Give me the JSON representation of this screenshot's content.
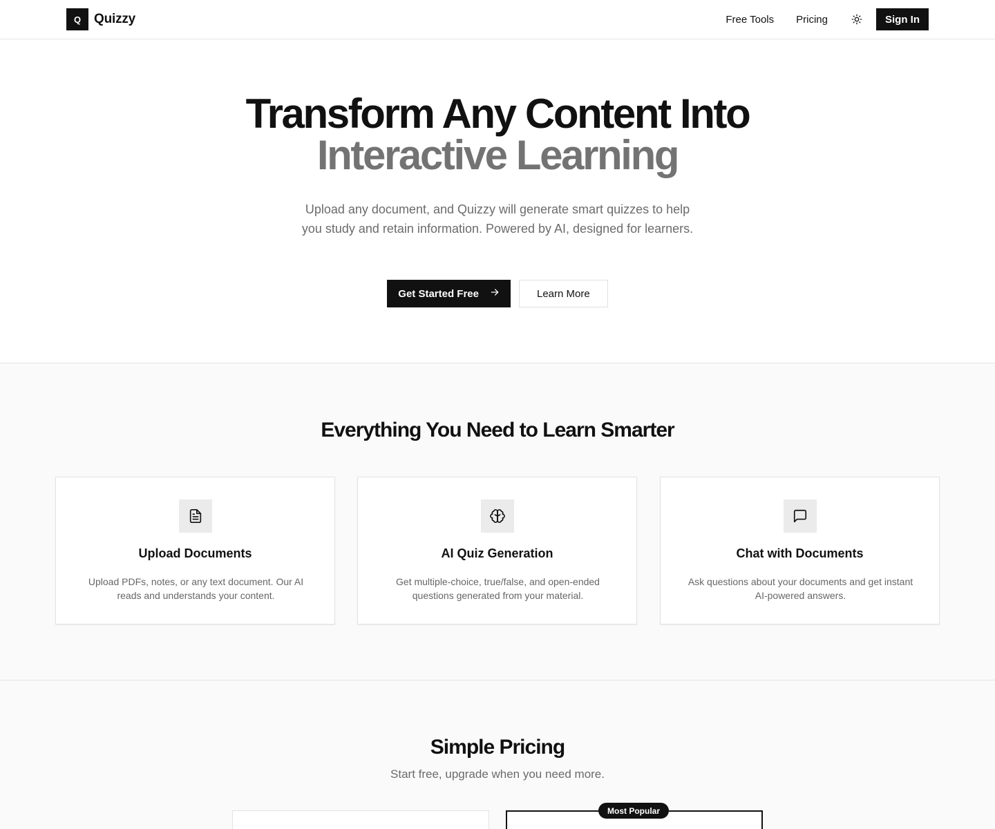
{
  "header": {
    "logo_letter": "Q",
    "brand_name": "Quizzy",
    "nav": [
      {
        "label": "Free Tools"
      },
      {
        "label": "Pricing"
      }
    ],
    "theme_icon": "sun-icon",
    "sign_in_label": "Sign In"
  },
  "hero": {
    "title_line1": "Transform Any Content Into",
    "title_line2": "Interactive Learning",
    "subtitle": "Upload any document, and Quizzy will generate smart quizzes to help you study and retain information. Powered by AI, designed for learners.",
    "primary_cta": "Get Started Free",
    "primary_cta_icon": "arrow-right-icon",
    "secondary_cta": "Learn More"
  },
  "features": {
    "title": "Everything You Need to Learn Smarter",
    "items": [
      {
        "icon": "document-icon",
        "title": "Upload Documents",
        "description": "Upload PDFs, notes, or any text document. Our AI reads and understands your content."
      },
      {
        "icon": "brain-icon",
        "title": "AI Quiz Generation",
        "description": "Get multiple-choice, true/false, and open-ended questions generated from your material."
      },
      {
        "icon": "chat-icon",
        "title": "Chat with Documents",
        "description": "Ask questions about your documents and get instant AI-powered answers."
      }
    ]
  },
  "pricing": {
    "title": "Simple Pricing",
    "subtitle": "Start free, upgrade when you need more.",
    "popular_badge": "Most Popular"
  },
  "colors": {
    "primary": "#111111",
    "muted_text": "#737373",
    "section_bg": "#fafafa",
    "icon_bg": "#ebebeb"
  }
}
